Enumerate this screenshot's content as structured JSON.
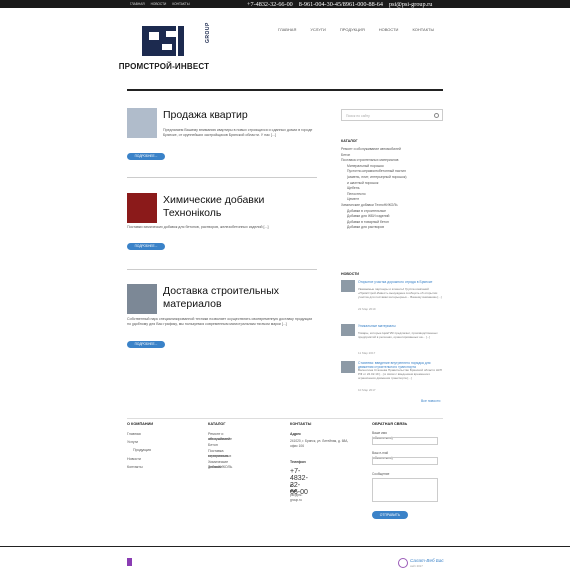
{
  "topbar": {
    "nav": [
      "ГЛАВНАЯ",
      "НОВОСТИ",
      "КОНТАКТЫ"
    ],
    "phones": [
      "+7-4832-32-66-00",
      "8-961-004-30-45/8961-000-88-64",
      "psi@psi-group.ru"
    ]
  },
  "logo": {
    "group": "GROUP",
    "brand": "ПРОМСТРОЙ-ИНВЕСТ"
  },
  "mainnav": [
    "ГЛАВНАЯ",
    "УСЛУГИ",
    "ПРОДУКЦИЯ",
    "НОВОСТИ",
    "КОНТАКТЫ"
  ],
  "posts": [
    {
      "title": "Продажа квартир",
      "desc": "Предлагаем Вашему вниманию квартиры в новых строящихся и сданных домах в городе Брянске, от крупнейших застройщиков Брянской области. У нас [...]",
      "button": "ПОДРОБНЕЕ..."
    },
    {
      "title": "Химические добавки Техноніколь",
      "desc": "Поставки химических добавок для бетонов, растворов, железобетонных изделий [...]",
      "button": "ПОДРОБНЕЕ..."
    },
    {
      "title": "Доставка строительных материалов",
      "desc": "Собственный парк специализированной техники позволяет осуществлять своевременную доставку продукции по удобному для Вас графику, мы пользуемся современным магистральным тягачом марки [...]",
      "button": "ПОДРОБНЕЕ..."
    }
  ],
  "sidebar": {
    "search_placeholder": "Поиск по сайту",
    "catalog_title": "КАТАЛОГ",
    "catalog": [
      {
        "label": "Ремонт и обслуживание автомобилей",
        "sub": false
      },
      {
        "label": "Бетон",
        "sub": false
      },
      {
        "label": "Поставка строительных материалов",
        "sub": false
      },
      {
        "label": "Минеральный порошок",
        "sub": true
      },
      {
        "label": "Пустотно-керамзитобетонный настил",
        "sub": true
      },
      {
        "label": "(камень, плит, интерьерный порошок)",
        "sub": true
      },
      {
        "label": "и шахтный порошок",
        "sub": true
      },
      {
        "label": "Щебень",
        "sub": true
      },
      {
        "label": "Пеностекло",
        "sub": true
      },
      {
        "label": "Цемент",
        "sub": true
      },
      {
        "label": "Химические добавки ТехноНИКОЛЬ",
        "sub": false
      },
      {
        "label": "Добавки в строительные",
        "sub": true
      },
      {
        "label": "Добавки для ЖБИ изделий",
        "sub": true
      },
      {
        "label": "Добавки в товарный бетон",
        "sub": true
      },
      {
        "label": "Добавки для растворов",
        "sub": true
      }
    ],
    "news_title": "НОВОСТИ",
    "news": [
      {
        "title": "Открытие участка дорожного отряда в Брянске",
        "desc": "Уважаемые партнеры и клиенты! Группа компаний «ПромСтрой-Инвест» вынуждена сообщить об открытии участка для поставки интерьерных... Вашему вниманию [...]",
        "date": "22 Мар 2019"
      },
      {
        "title": "Уникальные материалы",
        "desc": "Товары, которые ЦемГИК предлагает, производственных предприятий в регионах, ориентированных на... [...]",
        "date": "11 Мар 2017"
      },
      {
        "title": "Стахеева: введение внутреннего порядка для движения строительного транспорта",
        "desc": "Валентина Стахеева Правительство Брянской области НКП РФ от 22.02.19 [...] в связи с введением временного ограничения движения транспорта [...]",
        "date": "10 Мар 2017"
      }
    ],
    "all_news": "Все новости"
  },
  "footer": {
    "col1": {
      "title": "О КОМПАНИИ",
      "links": [
        "Главная",
        "Услуги",
        "Продукция",
        "Новости",
        "Контакты"
      ]
    },
    "col2": {
      "title": "КАТАЛОГ",
      "links": [
        "Ремонт и обслуживание",
        "автомобилей",
        "Бетон",
        "Поставка строительных",
        "материалов",
        "Химические добавки",
        "ТехноНИКОЛЬ"
      ]
    },
    "col3": {
      "title": "КОНТАКТЫ",
      "address_label": "Адрес",
      "address": "241020, г. Брянск, ул. Литейная, д. 68А, офис 106",
      "phone_label": "Телефон",
      "phone": "+7-4832-32-66-00",
      "email_label": "E-mail",
      "email": "psi@psi-group.ru"
    },
    "col4": {
      "title": "ОБРАТНАЯ СВЯЗЬ",
      "name_label": "Ваше имя (обязательно)",
      "email_label": "Ваш e-mail (обязательно)",
      "message_label": "Сообщение",
      "button": "ОТПРАВИТЬ"
    }
  },
  "dev": {
    "name": "Салат-Веб Бас",
    "sub": "сайт 2017"
  }
}
